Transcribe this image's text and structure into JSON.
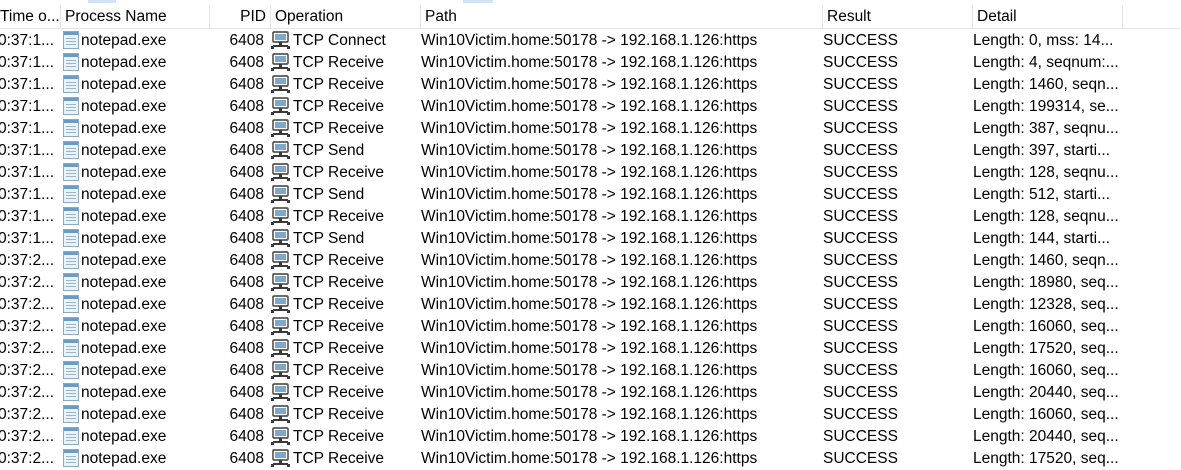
{
  "columns": {
    "time": "Time o...",
    "process": "Process Name",
    "pid": "PID",
    "operation": "Operation",
    "path": "Path",
    "result": "Result",
    "detail": "Detail"
  },
  "icons": {
    "process": "notepad-icon",
    "operation": "network-icon"
  },
  "rows": [
    {
      "time": "0:37:1...",
      "process": "notepad.exe",
      "pid": "6408",
      "operation": "TCP Connect",
      "path": "Win10Victim.home:50178 -> 192.168.1.126:https",
      "result": "SUCCESS",
      "detail": "Length: 0, mss: 14..."
    },
    {
      "time": "0:37:1...",
      "process": "notepad.exe",
      "pid": "6408",
      "operation": "TCP Receive",
      "path": "Win10Victim.home:50178 -> 192.168.1.126:https",
      "result": "SUCCESS",
      "detail": "Length: 4, seqnum:..."
    },
    {
      "time": "0:37:1...",
      "process": "notepad.exe",
      "pid": "6408",
      "operation": "TCP Receive",
      "path": "Win10Victim.home:50178 -> 192.168.1.126:https",
      "result": "SUCCESS",
      "detail": "Length: 1460, seqn..."
    },
    {
      "time": "0:37:1...",
      "process": "notepad.exe",
      "pid": "6408",
      "operation": "TCP Receive",
      "path": "Win10Victim.home:50178 -> 192.168.1.126:https",
      "result": "SUCCESS",
      "detail": "Length: 199314, se..."
    },
    {
      "time": "0:37:1...",
      "process": "notepad.exe",
      "pid": "6408",
      "operation": "TCP Receive",
      "path": "Win10Victim.home:50178 -> 192.168.1.126:https",
      "result": "SUCCESS",
      "detail": "Length: 387, seqnu..."
    },
    {
      "time": "0:37:1...",
      "process": "notepad.exe",
      "pid": "6408",
      "operation": "TCP Send",
      "path": "Win10Victim.home:50178 -> 192.168.1.126:https",
      "result": "SUCCESS",
      "detail": "Length: 397, starti..."
    },
    {
      "time": "0:37:1...",
      "process": "notepad.exe",
      "pid": "6408",
      "operation": "TCP Receive",
      "path": "Win10Victim.home:50178 -> 192.168.1.126:https",
      "result": "SUCCESS",
      "detail": "Length: 128, seqnu..."
    },
    {
      "time": "0:37:1...",
      "process": "notepad.exe",
      "pid": "6408",
      "operation": "TCP Send",
      "path": "Win10Victim.home:50178 -> 192.168.1.126:https",
      "result": "SUCCESS",
      "detail": "Length: 512, starti..."
    },
    {
      "time": "0:37:1...",
      "process": "notepad.exe",
      "pid": "6408",
      "operation": "TCP Receive",
      "path": "Win10Victim.home:50178 -> 192.168.1.126:https",
      "result": "SUCCESS",
      "detail": "Length: 128, seqnu..."
    },
    {
      "time": "0:37:1...",
      "process": "notepad.exe",
      "pid": "6408",
      "operation": "TCP Send",
      "path": "Win10Victim.home:50178 -> 192.168.1.126:https",
      "result": "SUCCESS",
      "detail": "Length: 144, starti..."
    },
    {
      "time": "0:37:2...",
      "process": "notepad.exe",
      "pid": "6408",
      "operation": "TCP Receive",
      "path": "Win10Victim.home:50178 -> 192.168.1.126:https",
      "result": "SUCCESS",
      "detail": "Length: 1460, seqn..."
    },
    {
      "time": "0:37:2...",
      "process": "notepad.exe",
      "pid": "6408",
      "operation": "TCP Receive",
      "path": "Win10Victim.home:50178 -> 192.168.1.126:https",
      "result": "SUCCESS",
      "detail": "Length: 18980, seq..."
    },
    {
      "time": "0:37:2...",
      "process": "notepad.exe",
      "pid": "6408",
      "operation": "TCP Receive",
      "path": "Win10Victim.home:50178 -> 192.168.1.126:https",
      "result": "SUCCESS",
      "detail": "Length: 12328, seq..."
    },
    {
      "time": "0:37:2...",
      "process": "notepad.exe",
      "pid": "6408",
      "operation": "TCP Receive",
      "path": "Win10Victim.home:50178 -> 192.168.1.126:https",
      "result": "SUCCESS",
      "detail": "Length: 16060, seq..."
    },
    {
      "time": "0:37:2...",
      "process": "notepad.exe",
      "pid": "6408",
      "operation": "TCP Receive",
      "path": "Win10Victim.home:50178 -> 192.168.1.126:https",
      "result": "SUCCESS",
      "detail": "Length: 17520, seq..."
    },
    {
      "time": "0:37:2...",
      "process": "notepad.exe",
      "pid": "6408",
      "operation": "TCP Receive",
      "path": "Win10Victim.home:50178 -> 192.168.1.126:https",
      "result": "SUCCESS",
      "detail": "Length: 16060, seq..."
    },
    {
      "time": "0:37:2...",
      "process": "notepad.exe",
      "pid": "6408",
      "operation": "TCP Receive",
      "path": "Win10Victim.home:50178 -> 192.168.1.126:https",
      "result": "SUCCESS",
      "detail": "Length: 20440, seq..."
    },
    {
      "time": "0:37:2...",
      "process": "notepad.exe",
      "pid": "6408",
      "operation": "TCP Receive",
      "path": "Win10Victim.home:50178 -> 192.168.1.126:https",
      "result": "SUCCESS",
      "detail": "Length: 16060, seq..."
    },
    {
      "time": "0:37:2...",
      "process": "notepad.exe",
      "pid": "6408",
      "operation": "TCP Receive",
      "path": "Win10Victim.home:50178 -> 192.168.1.126:https",
      "result": "SUCCESS",
      "detail": "Length: 20440, seq..."
    },
    {
      "time": "0:37:2...",
      "process": "notepad.exe",
      "pid": "6408",
      "operation": "TCP Receive",
      "path": "Win10Victim.home:50178 -> 192.168.1.126:https",
      "result": "SUCCESS",
      "detail": "Length: 17520, seq..."
    }
  ]
}
